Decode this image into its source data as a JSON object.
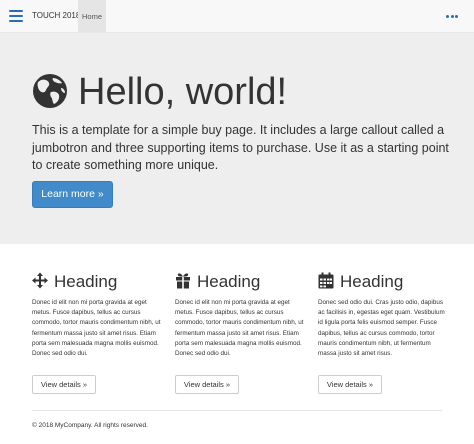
{
  "navbar": {
    "brand": "TOUCH 2018",
    "home_label": "Home",
    "menu_icon": "hamburger-menu-icon",
    "more_icon": "ellipsis-icon"
  },
  "jumbotron": {
    "icon": "globe-icon",
    "title": "Hello, world!",
    "text": "This is a template for a simple buy page. It includes a large callout called a jumbotron and three supporting items to purchase. Use it as a starting point to create something more unique.",
    "button_label": "Learn more »"
  },
  "columns": [
    {
      "icon": "move-arrows-icon",
      "heading": "Heading",
      "text": "Donec id elit non mi porta gravida at eget metus. Fusce dapibus, tellus ac cursus commodo, tortor mauris condimentum nibh, ut fermentum massa justo sit amet risus. Etiam porta sem malesuada magna mollis euismod. Donec sed odio dui.",
      "button_label": "View details »"
    },
    {
      "icon": "gift-icon",
      "heading": "Heading",
      "text": "Donec id elit non mi porta gravida at eget metus. Fusce dapibus, tellus ac cursus commodo, tortor mauris condimentum nibh, ut fermentum massa justo sit amet risus. Etiam porta sem malesuada magna mollis euismod. Donec sed odio dui.",
      "button_label": "View details »"
    },
    {
      "icon": "calendar-icon",
      "heading": "Heading",
      "text": "Donec sed odio dui. Cras justo odio, dapibus ac facilisis in, egestas eget quam. Vestibulum id ligula porta felis euismod semper. Fusce dapibus, tellus ac cursus commodo, tortor mauris condimentum nibh, ut fermentum massa justo sit amet risus.",
      "button_label": "View details »"
    }
  ],
  "footer": {
    "text": "© 2018 MyCompany. All rights reserved."
  },
  "colors": {
    "primary": "#428bca",
    "nav_icon": "#2a6db5",
    "jumbotron_bg": "#eeeeee",
    "navbar_bg": "#f8f8f8"
  }
}
